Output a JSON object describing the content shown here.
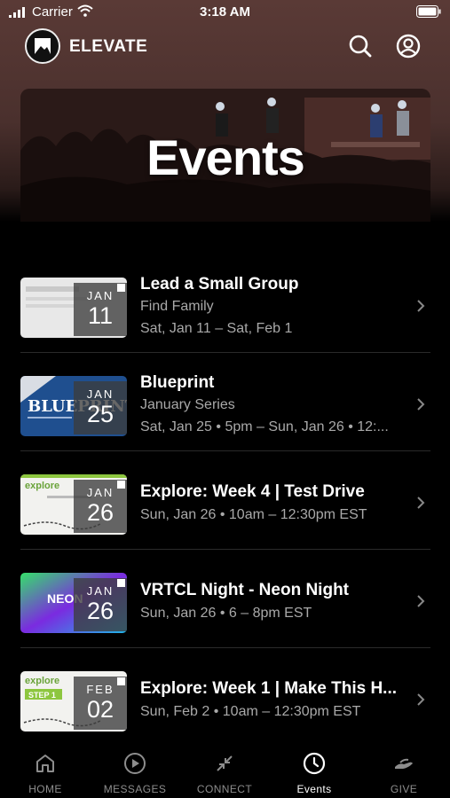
{
  "status_bar": {
    "carrier": "Carrier",
    "time": "3:18 AM"
  },
  "header": {
    "brand": "ELEVATE"
  },
  "hero": {
    "title": "Events"
  },
  "events": [
    {
      "title": "Lead a Small Group",
      "subtitle": "Find Family",
      "dates": "Sat, Jan 11 – Sat, Feb 1",
      "month": "JAN",
      "day": "11"
    },
    {
      "title": "Blueprint",
      "subtitle": "January Series",
      "dates": "Sat, Jan 25 • 5pm – Sun, Jan 26 • 12:...",
      "month": "JAN",
      "day": "25",
      "thumb_text": "BLUEPRINT"
    },
    {
      "title": "Explore: Week 4 | Test Drive",
      "subtitle": "",
      "dates": "Sun, Jan 26 • 10am – 12:30pm EST",
      "month": "JAN",
      "day": "26",
      "thumb_text": "explore"
    },
    {
      "title": "VRTCL Night - Neon Night",
      "subtitle": "",
      "dates": "Sun, Jan 26 • 6 – 8pm EST",
      "month": "JAN",
      "day": "26",
      "thumb_text": "NEON"
    },
    {
      "title": "Explore: Week 1 | Make This H...",
      "subtitle": "",
      "dates": "Sun, Feb 2 • 10am – 12:30pm EST",
      "month": "FEB",
      "day": "02",
      "thumb_text": "explore",
      "thumb_text2": "STEP 1"
    }
  ],
  "tabs": [
    {
      "label": "HOME",
      "icon": "home-icon"
    },
    {
      "label": "MESSAGES",
      "icon": "play-circle-icon"
    },
    {
      "label": "CONNECT",
      "icon": "connect-arrows-icon"
    },
    {
      "label": "Events",
      "icon": "clock-icon",
      "active": true
    },
    {
      "label": "GIVE",
      "icon": "give-hand-icon"
    }
  ],
  "colors": {
    "background": "#000000",
    "header_brown": "#5a3a36",
    "accent_green": "#8dc63f",
    "muted_text": "#a9a9a9"
  }
}
